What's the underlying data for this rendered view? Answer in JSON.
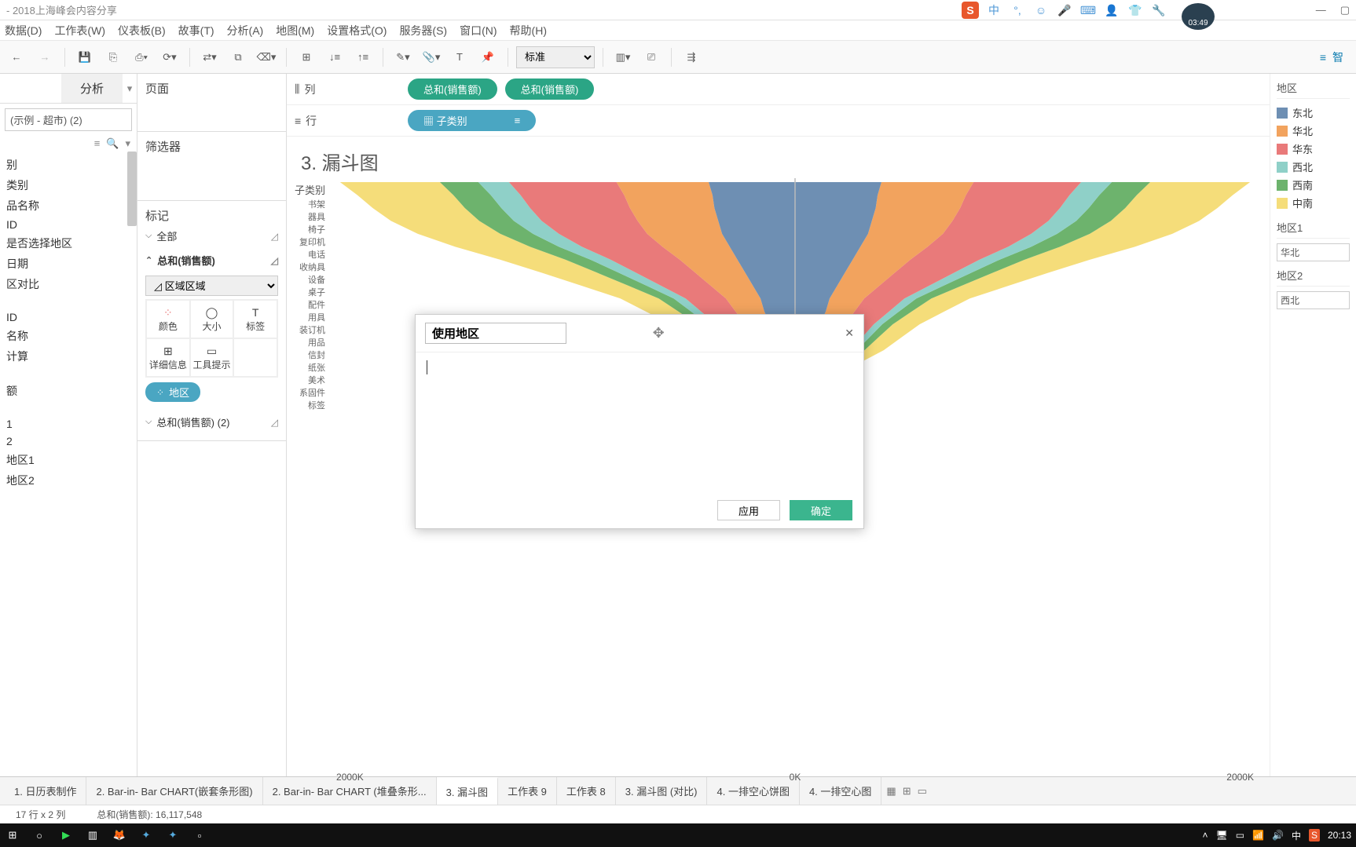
{
  "window": {
    "title": "- 2018上海峰会内容分享"
  },
  "menu": [
    "数据(D)",
    "工作表(W)",
    "仪表板(B)",
    "故事(T)",
    "分析(A)",
    "地图(M)",
    "设置格式(O)",
    "服务器(S)",
    "窗口(N)",
    "帮助(H)"
  ],
  "toolbar": {
    "mode": "标准",
    "smart": "智"
  },
  "overlay": {
    "sogou": "S",
    "ime": "中",
    "time": "03:49"
  },
  "leftpane": {
    "tabs": [
      "",
      "分析"
    ],
    "datasource": "(示例 - 超市) (2)",
    "fields": [
      "别",
      "类别",
      "品名称",
      "ID",
      "是否选择地区",
      "日期",
      "区对比",
      "",
      "ID",
      "名称",
      "计算",
      "",
      "额",
      "",
      "1",
      "2",
      "地区1",
      "地区2"
    ]
  },
  "cards": {
    "pages": "页面",
    "filters": "筛选器",
    "marks": "标记",
    "all": "全部",
    "sumSales": "总和(销售额)",
    "sumSales2": "总和(销售额) (2)",
    "markType": "区域",
    "cells": {
      "color": "颜色",
      "size": "大小",
      "label": "标签",
      "detail": "详细信息",
      "tooltip": "工具提示"
    },
    "pillRegion": "地区"
  },
  "shelves": {
    "columns": {
      "label": "列",
      "pills": [
        "总和(销售额)",
        "总和(销售额)"
      ]
    },
    "rows": {
      "label": "行",
      "pill": "子类别"
    }
  },
  "viz": {
    "title": "3. 漏斗图",
    "yHeader": "子类别",
    "yLabels": [
      "书架",
      "器具",
      "椅子",
      "复印机",
      "电话",
      "收纳具",
      "设备",
      "桌子",
      "配件",
      "用具",
      "装订机",
      "用品",
      "信封",
      "纸张",
      "美术",
      "系固件",
      "标签"
    ],
    "xTicks": [
      "2000K",
      "0K",
      "2000K"
    ],
    "xTickHidden": "0K"
  },
  "legend": {
    "title": "地区",
    "items": [
      {
        "label": "东北",
        "color": "#6e8fb3"
      },
      {
        "label": "华北",
        "color": "#f2a35e"
      },
      {
        "label": "华东",
        "color": "#e97a7a"
      },
      {
        "label": "西北",
        "color": "#8fd0c8"
      },
      {
        "label": "西南",
        "color": "#6db36d"
      },
      {
        "label": "中南",
        "color": "#f5dd7a"
      }
    ],
    "param1": {
      "title": "地区1",
      "value": "华北"
    },
    "param2": {
      "title": "地区2",
      "value": "西北"
    }
  },
  "dialog": {
    "title": "使用地区",
    "apply": "应用",
    "ok": "确定"
  },
  "sheets": [
    "1. 日历表制作",
    "2. Bar-in- Bar CHART(嵌套条形图)",
    "2. Bar-in- Bar CHART (堆叠条形...",
    "3. 漏斗图",
    "工作表 9",
    "工作表 8",
    "3. 漏斗图 (对比)",
    "4. 一排空心饼图",
    "4. 一排空心图"
  ],
  "activeSheet": "3. 漏斗图",
  "status": {
    "rows": "17 行 x 2 列",
    "sum": "总和(销售额): 16,117,548"
  },
  "taskbar": {
    "ime": "中",
    "time": "20:13"
  },
  "chart_data": {
    "type": "area",
    "note": "Mirrored funnel (stacked area) of sales by sub-category, split by region; left side is negative mirror.",
    "categories": [
      "书架",
      "器具",
      "椅子",
      "复印机",
      "电话",
      "收纳具",
      "设备",
      "桌子",
      "配件",
      "用具",
      "装订机",
      "用品",
      "信封",
      "纸张",
      "美术",
      "系固件",
      "标签"
    ],
    "xlabel": "总和(销售额)",
    "ylabel": "子类别",
    "xlim": [
      -2200000,
      2200000
    ],
    "series": [
      {
        "name": "东北",
        "color": "#6e8fb3",
        "values": [
          450000,
          430000,
          420000,
          400000,
          380000,
          340000,
          300000,
          260000,
          220000,
          180000,
          160000,
          130000,
          110000,
          90000,
          60000,
          45000,
          30000
        ]
      },
      {
        "name": "华北",
        "color": "#f2a35e",
        "values": [
          480000,
          460000,
          440000,
          420000,
          390000,
          350000,
          300000,
          260000,
          220000,
          180000,
          150000,
          130000,
          110000,
          90000,
          65000,
          48000,
          32000
        ]
      },
      {
        "name": "华东",
        "color": "#e97a7a",
        "values": [
          560000,
          540000,
          520000,
          500000,
          460000,
          420000,
          360000,
          310000,
          260000,
          210000,
          180000,
          150000,
          130000,
          110000,
          80000,
          55000,
          38000
        ]
      },
      {
        "name": "西北",
        "color": "#8fd0c8",
        "values": [
          160000,
          155000,
          150000,
          145000,
          135000,
          120000,
          105000,
          90000,
          75000,
          62000,
          52000,
          44000,
          38000,
          32000,
          24000,
          18000,
          12000
        ]
      },
      {
        "name": "西南",
        "color": "#6db36d",
        "values": [
          200000,
          195000,
          190000,
          180000,
          170000,
          150000,
          130000,
          112000,
          95000,
          78000,
          66000,
          55000,
          47000,
          40000,
          30000,
          22000,
          15000
        ]
      },
      {
        "name": "中南",
        "color": "#f5dd7a",
        "values": [
          520000,
          500000,
          480000,
          460000,
          430000,
          390000,
          340000,
          290000,
          245000,
          200000,
          170000,
          140000,
          120000,
          100000,
          75000,
          52000,
          35000
        ]
      }
    ]
  }
}
